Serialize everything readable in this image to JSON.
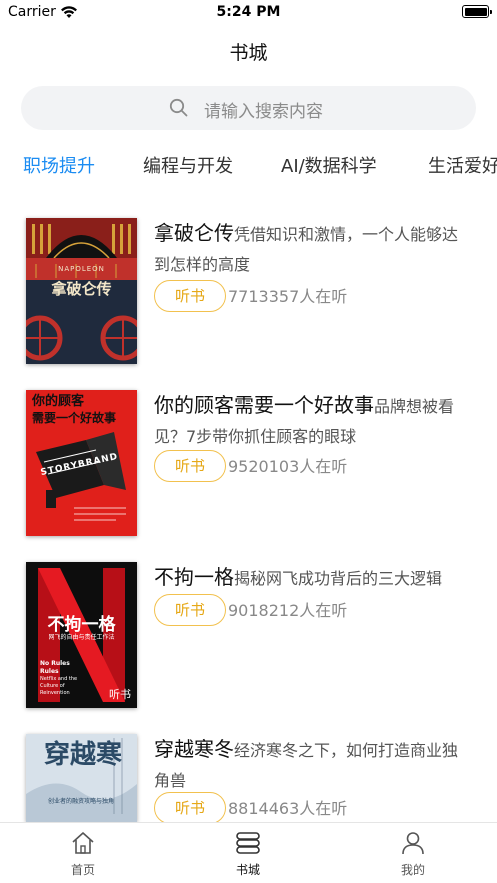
{
  "status_bar": {
    "carrier": "Carrier",
    "time": "5:24 PM"
  },
  "nav": {
    "title": "书城"
  },
  "search": {
    "placeholder": "请输入搜索内容"
  },
  "tabs": [
    {
      "label": "职场提升",
      "active": true
    },
    {
      "label": "编程与开发",
      "active": false
    },
    {
      "label": "AI/数据科学",
      "active": false
    },
    {
      "label": "生活爱好",
      "active": false
    }
  ],
  "books": [
    {
      "title": "拿破仑传",
      "description": "凭借知识和激情，一个人能够达到怎样的高度",
      "listen_label": "听书",
      "listeners": "7713357人在听",
      "cover": {
        "top_text": "NAPOLEON",
        "title": "拿破仑传",
        "bg": "#1f2a3d",
        "accent": "#c0312b"
      }
    },
    {
      "title": "你的顾客需要一个好故事",
      "description": "品牌想被看见？7步带你抓住顾客的眼球",
      "listen_label": "听书",
      "listeners": "9520103人在听",
      "cover": {
        "line1": "你的顾客",
        "line2": "需要一个好故事",
        "word": "STORYBRAND",
        "bg": "#e0201b"
      }
    },
    {
      "title": "不拘一格",
      "description": "揭秘网飞成功背后的三大逻辑",
      "listen_label": "听书",
      "listeners": "9018212人在听",
      "cover": {
        "title": "不拘一格",
        "sub": "网飞的自由与责任工作法",
        "en1": "No Rules",
        "en2": "Rules",
        "en3": "Netflix and the Culture of Reinvention",
        "badge": "听书",
        "bg": "#0d0d0d",
        "accent": "#d4101a"
      }
    },
    {
      "title": "穿越寒冬",
      "description": "经济寒冬之下，如何打造商业独角兽",
      "listen_label": "听书",
      "listeners": "8814463人在听",
      "cover": {
        "title": "穿越寒",
        "sub": "创业者的融资攻略与独角",
        "bg": "#c9d6e2"
      }
    }
  ],
  "tab_bar": [
    {
      "label": "首页",
      "icon": "home-icon",
      "active": false
    },
    {
      "label": "书城",
      "icon": "bookstore-icon",
      "active": true
    },
    {
      "label": "我的",
      "icon": "profile-icon",
      "active": false
    }
  ],
  "colors": {
    "accent": "#1b8cf2",
    "listen_border": "#f2c14e",
    "listen_text": "#e6a817"
  }
}
